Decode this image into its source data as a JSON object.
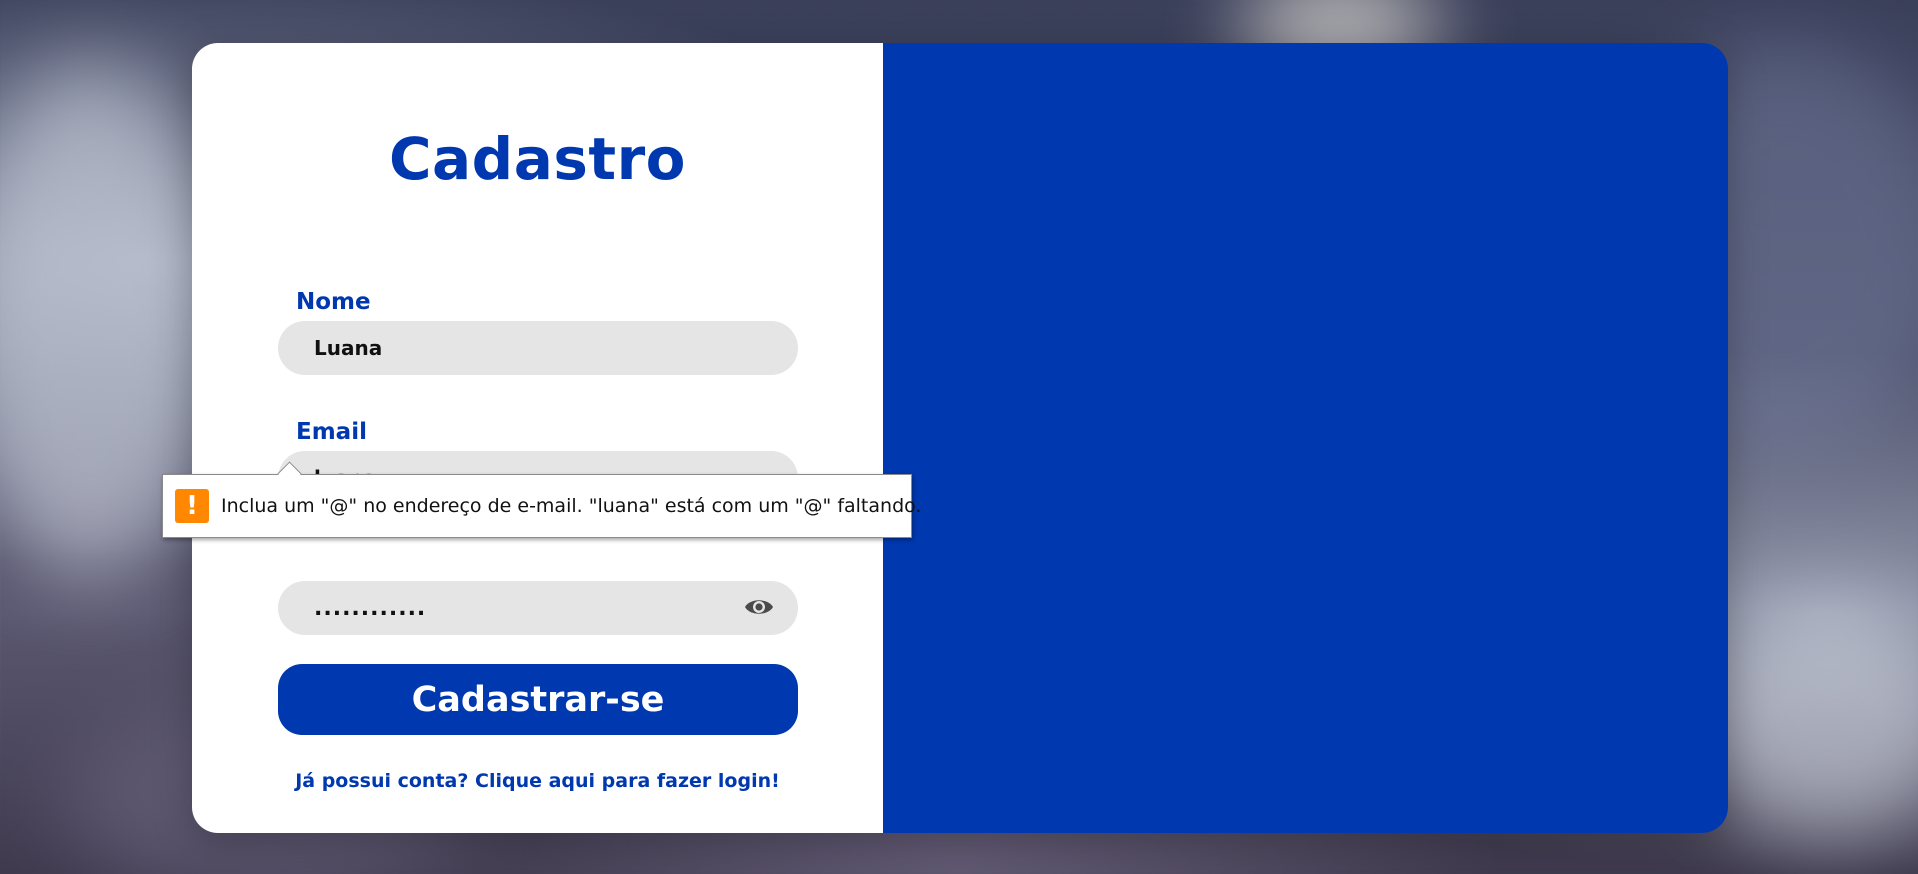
{
  "page": {
    "title": "Cadastro"
  },
  "form": {
    "name": {
      "label": "Nome",
      "value": "Luana"
    },
    "email": {
      "label": "Email",
      "value": "luana"
    },
    "password": {
      "value": "............",
      "toggle_icon": "eye-icon"
    },
    "submit_label": "Cadastrar-se",
    "login_link": "Já possui conta? Clique aqui para fazer login!"
  },
  "validation_tooltip": {
    "icon": "warning-icon",
    "icon_glyph": "!",
    "message": "Inclua um \"@\" no endereço de e-mail. \"luana\" está com um \"@\" faltando."
  },
  "colors": {
    "primary": "#0038b0",
    "input_bg": "#e5e5e5",
    "warning": "#ff8800"
  }
}
